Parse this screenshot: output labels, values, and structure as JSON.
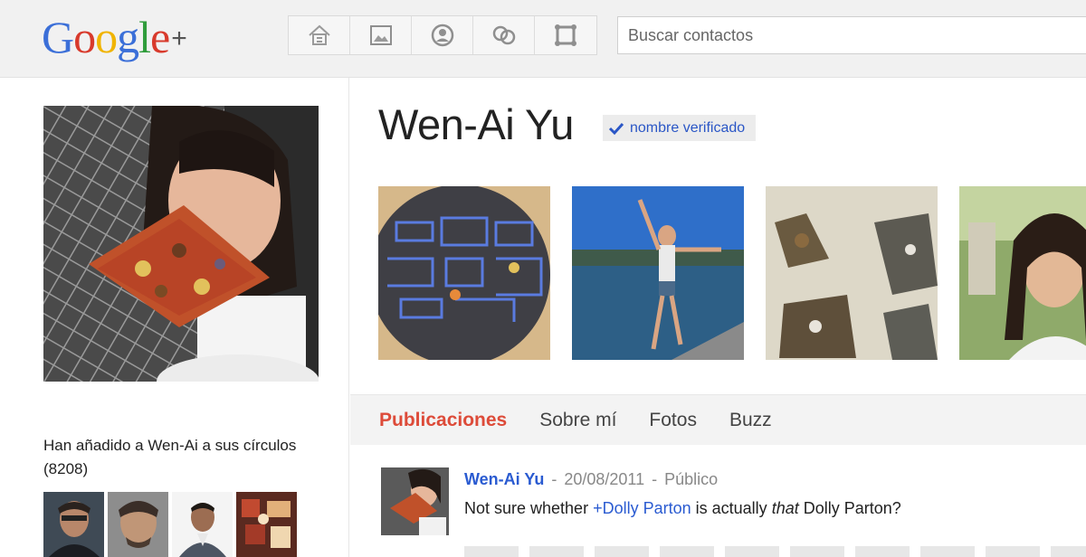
{
  "header": {
    "logo_text": "Google",
    "logo_plus": "+",
    "nav": [
      {
        "icon": "home-icon"
      },
      {
        "icon": "photos-icon"
      },
      {
        "icon": "profile-icon"
      },
      {
        "icon": "circles-icon"
      },
      {
        "icon": "games-icon"
      }
    ],
    "search_placeholder": "Buscar contactos"
  },
  "profile": {
    "name": "Wen-Ai Yu",
    "verified_label": "nombre verificado",
    "circles_title": "Han añadido a Wen-Ai a sus círculos (8208)",
    "circle_people_count_shown": 4
  },
  "tabs": [
    {
      "label": "Publicaciones",
      "active": true
    },
    {
      "label": "Sobre mí",
      "active": false
    },
    {
      "label": "Fotos",
      "active": false
    },
    {
      "label": "Buzz",
      "active": false
    }
  ],
  "post": {
    "author": "Wen-Ai Yu",
    "separator": "-",
    "date": "20/08/2011",
    "visibility": "Público",
    "text_before": "Not sure whether ",
    "mention": "+Dolly Parton",
    "text_middle": " is actually ",
    "text_italic": "that",
    "text_after": " Dolly Parton?"
  },
  "colors": {
    "accent_red": "#dd4b39",
    "link_blue": "#2a5bd1",
    "verified_blue": "#2a56c6"
  }
}
